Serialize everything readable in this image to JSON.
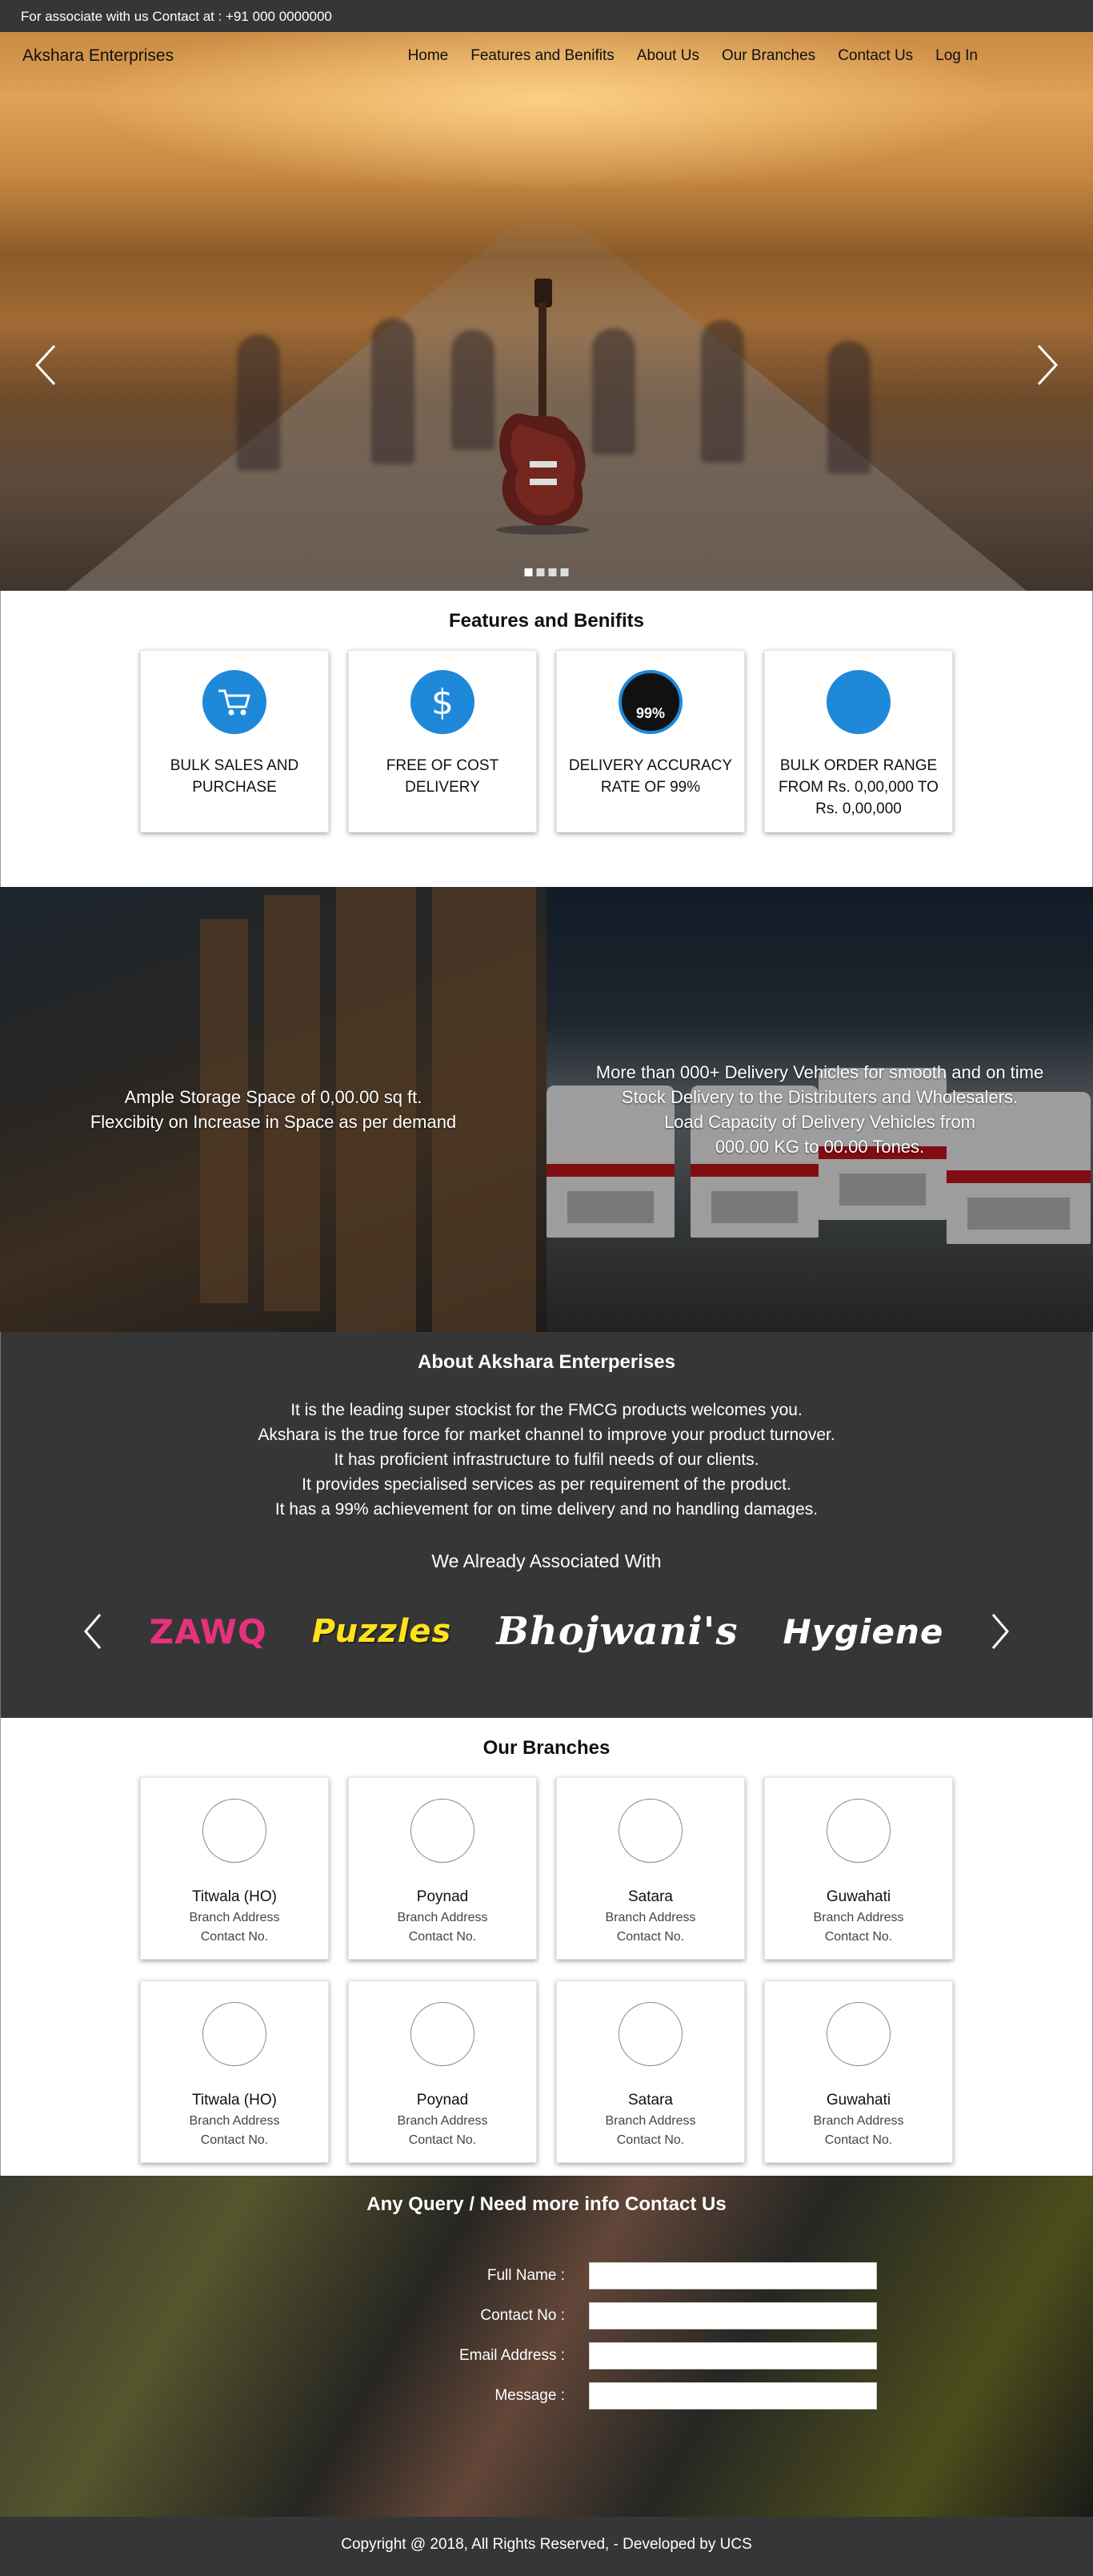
{
  "topbar": {
    "text": "For associate with us Contact at : +91 000 0000000"
  },
  "nav": {
    "brand": "Akshara Enterprises",
    "items": [
      "Home",
      "Features and Benifits",
      "About Us",
      "Our Branches",
      "Contact Us",
      "Log In"
    ]
  },
  "features": {
    "title": "Features and Benifits",
    "cards": [
      {
        "icon": "shopping-cart-icon",
        "label": "BULK SALES AND PURCHASE"
      },
      {
        "icon": "dollar-icon",
        "label": "FREE OF COST DELIVERY"
      },
      {
        "icon": "delivery-accuracy-icon",
        "badge": "99%",
        "label": "DELIVERY ACCURACY RATE OF 99%"
      },
      {
        "icon": "order-range-icon",
        "label": "BULK ORDER RANGE FROM Rs. 0,00,000 TO Rs. 0,00,000"
      }
    ]
  },
  "split": {
    "storage": [
      "Ample Storage Space of 0,00.00 sq ft.",
      "Flexcibity on Increase in Space as per demand"
    ],
    "fleet": [
      "More than 000+ Delivery Vehicles for smooth and on time",
      "Stock Delivery to the Distributers and Wholesalers.",
      "Load Capacity of Delivery Vehicles from",
      "000.00 KG to 00.00 Tones."
    ]
  },
  "about": {
    "title": "About Akshara Enterperises",
    "lines": [
      "It is the leading super stockist for the FMCG products welcomes you.",
      "Akshara is the true force for market channel to improve your product turnover.",
      "It has proficient infrastructure to fulfil needs of our clients.",
      "It provides specialised services as per requirement of the product.",
      "It has a 99% achievement for on time delivery and no handling damages."
    ],
    "associated_title": "We Already Associated With",
    "logos": [
      "ZAWQ",
      "Puzzles",
      "Bhojwani's",
      "Hygiene"
    ]
  },
  "branches": {
    "title": "Our Branches",
    "items": [
      {
        "name": "Titwala (HO)",
        "address": "Branch Address",
        "contact": "Contact No."
      },
      {
        "name": "Poynad",
        "address": "Branch Address",
        "contact": "Contact No."
      },
      {
        "name": "Satara",
        "address": "Branch Address",
        "contact": "Contact No."
      },
      {
        "name": "Guwahati",
        "address": "Branch Address",
        "contact": "Contact No."
      },
      {
        "name": "Titwala (HO)",
        "address": "Branch Address",
        "contact": "Contact No."
      },
      {
        "name": "Poynad",
        "address": "Branch Address",
        "contact": "Contact No."
      },
      {
        "name": "Satara",
        "address": "Branch Address",
        "contact": "Contact No."
      },
      {
        "name": "Guwahati",
        "address": "Branch Address",
        "contact": "Contact No."
      }
    ]
  },
  "contact": {
    "title": "Any Query / Need more info Contact Us",
    "fields": [
      {
        "label": "Full Name :",
        "value": ""
      },
      {
        "label": "Contact No :",
        "value": ""
      },
      {
        "label": "Email Address :",
        "value": ""
      },
      {
        "label": "Message :",
        "value": ""
      }
    ]
  },
  "footer": {
    "text": "Copyright @ 2018, All Rights Reserved, - Developed by UCS"
  },
  "colors": {
    "accent": "#1e88d9",
    "dark": "#363636"
  }
}
